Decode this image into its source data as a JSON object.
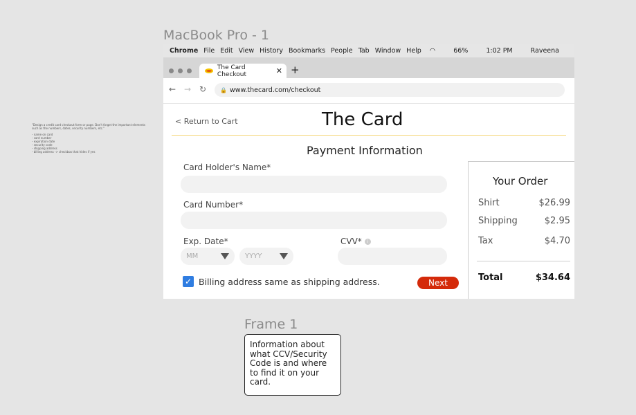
{
  "canvas": {
    "frame_title": "MacBook Pro - 1",
    "frame2_title": "Frame 1",
    "note": {
      "prompt": "\"Design a credit card checkout form or page. Don't forget the important elements such as the numbers, dates, security numbers, etc.\"",
      "items": [
        "- name on card",
        "- card number",
        "- expiration date",
        "- security code",
        "- shipping address",
        "- billing address -> checkbox that hides if yes"
      ]
    },
    "tooltip": "Information about what CCV/Security Code is and where to find it on your card."
  },
  "menubar": {
    "app": "Chrome",
    "items": [
      "File",
      "Edit",
      "View",
      "History",
      "Bookmarks",
      "People",
      "Tab",
      "Window",
      "Help"
    ],
    "battery": "66%",
    "time": "1:02 PM",
    "user": "Raveena"
  },
  "browser": {
    "tab_title": "The Card Checkout",
    "url": "www.thecard.com/checkout"
  },
  "page": {
    "back_link": "< Return to Cart",
    "brand": "The  Card",
    "section_title": "Payment Information",
    "name_label": "Card Holder's Name*",
    "number_label": "Card Number*",
    "exp_label": "Exp. Date*",
    "month_placeholder": "MM",
    "year_placeholder": "YYYY",
    "cvv_label": "CVV*",
    "billing_same": "Billing address same as shipping address.",
    "billing_checked": true,
    "next": "Next"
  },
  "order": {
    "title": "Your Order",
    "lines": [
      {
        "label": "Shirt",
        "value": "$26.99"
      },
      {
        "label": "Shipping",
        "value": "$2.95"
      },
      {
        "label": "Tax",
        "value": "$4.70"
      }
    ],
    "total_label": "Total",
    "total": "$34.64"
  },
  "colors": {
    "accent_line": "#f5d77a",
    "next_button": "#d42a0a",
    "checkbox": "#2f7de1"
  }
}
